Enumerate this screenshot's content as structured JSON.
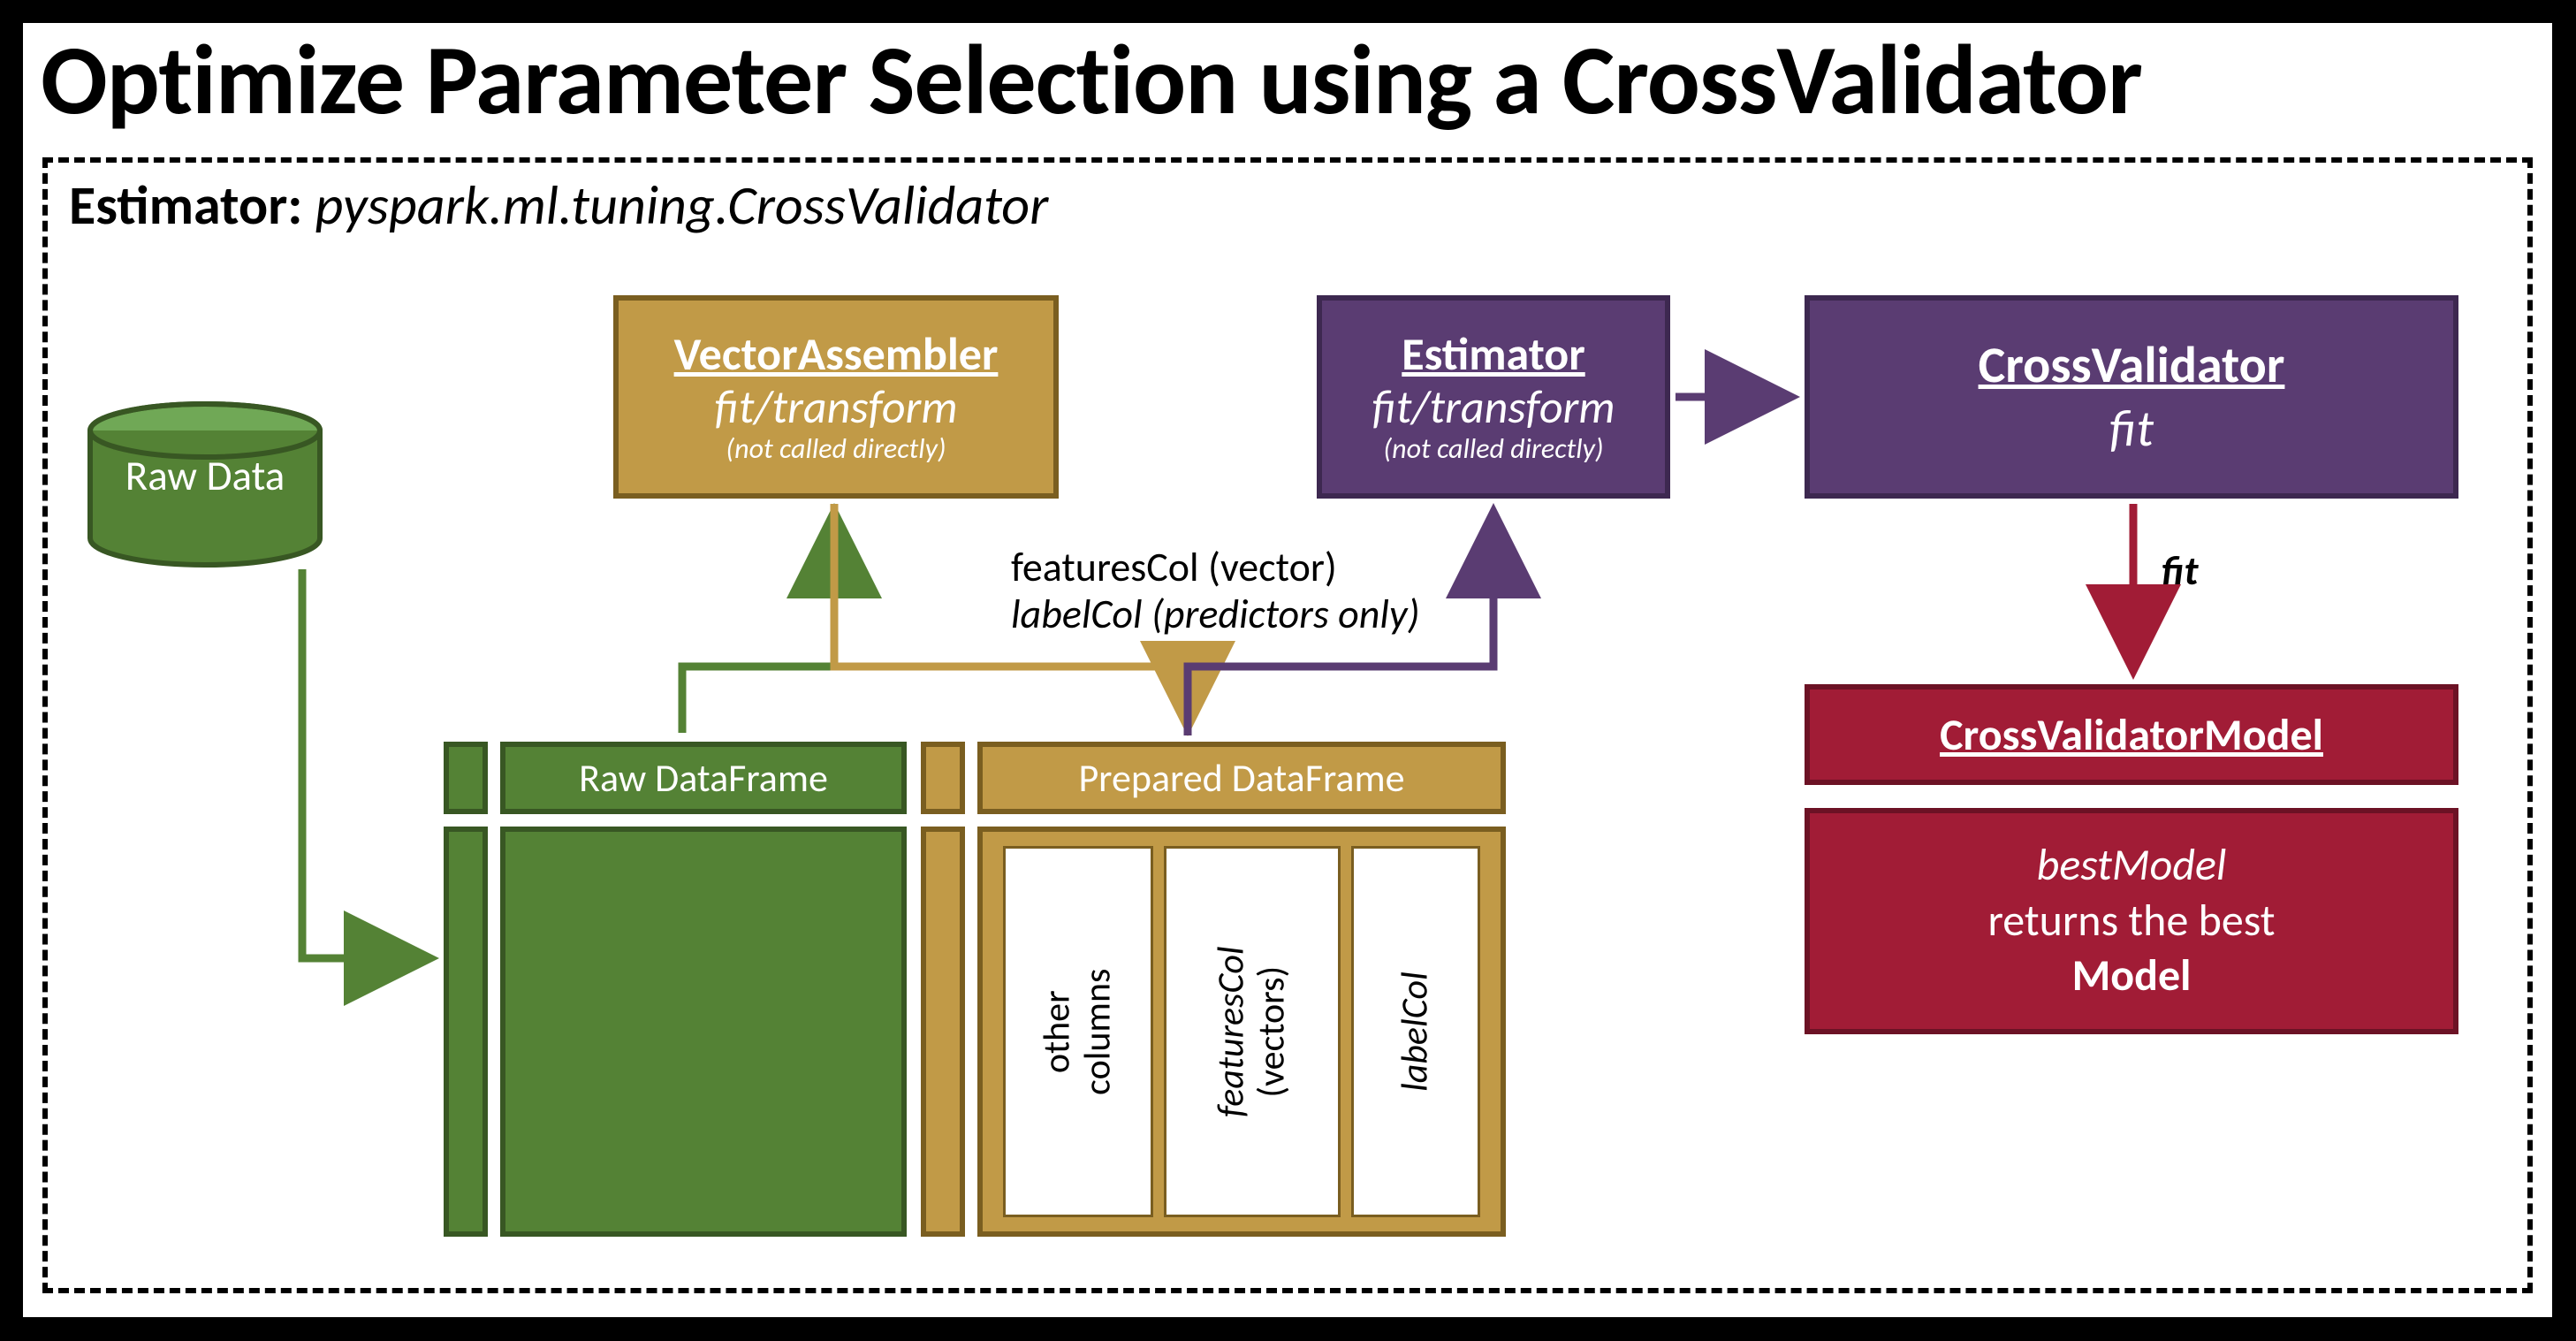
{
  "title": "Optimize Parameter Selection using a CrossValidator",
  "estimator_label": {
    "prefix": "Estimator: ",
    "value": "pyspark.ml.tuning.CrossValidator"
  },
  "raw_data_cylinder": "Raw Data",
  "vector_assembler": {
    "title": "VectorAssembler",
    "action": "fit/transform",
    "note": "(not called directly)"
  },
  "estimator": {
    "title": "Estimator",
    "action": "fit/transform",
    "note": "(not called directly)"
  },
  "cross_validator": {
    "title": "CrossValidator",
    "action": "fit"
  },
  "cv_model": {
    "title": "CrossValidatorModel"
  },
  "best_model": {
    "line1": "bestModel",
    "line2": "returns the best",
    "line3": "Model"
  },
  "raw_df_header": "Raw DataFrame",
  "prep_df_header": "Prepared DataFrame",
  "prep_cols": {
    "other": {
      "l1": "other",
      "l2": "columns"
    },
    "features": {
      "l1": "featuresCol",
      "l2": "(vectors)"
    },
    "label": "labelCol"
  },
  "features_text": {
    "l1": "featuresCol (vector)",
    "l2": "labelCol (predictors only)"
  },
  "fit_label": "fit",
  "colors": {
    "green": "#548235",
    "green_dark": "#385723",
    "gold": "#C19A47",
    "gold_dark": "#7A5E20",
    "purple": "#5A3C72",
    "purple_dark": "#3D2850",
    "red": "#A11C36",
    "red_dark": "#6C1225"
  }
}
